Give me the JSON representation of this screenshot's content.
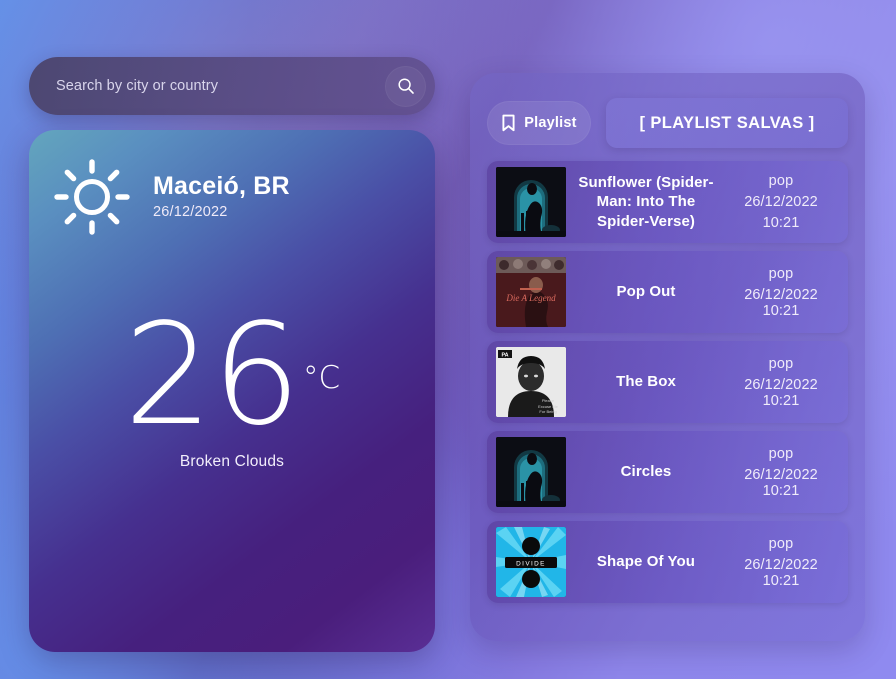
{
  "search": {
    "placeholder": "Search by city or country",
    "value": "",
    "icon": "search-icon"
  },
  "weather": {
    "icon": "sun-icon",
    "city": "Maceió, BR",
    "date": "26/12/2022",
    "temperature": "26",
    "unit": "°C",
    "description": "Broken Clouds"
  },
  "playlist": {
    "pill_label": "Playlist",
    "pill_icon": "bookmark-icon",
    "saved_button_label": "[ PLAYLIST SALVAS ]",
    "tracks": [
      {
        "title": "Sunflower (Spider-Man: Into The Spider-Verse)",
        "genre": "pop",
        "date": "26/12/2022",
        "time": "10:21",
        "cover": "sunflower-cover"
      },
      {
        "title": "Pop Out",
        "genre": "pop",
        "date": "26/12/2022",
        "time": "10:21",
        "cover": "pop-out-cover"
      },
      {
        "title": "The Box",
        "genre": "pop",
        "date": "26/12/2022",
        "time": "10:21",
        "cover": "the-box-cover"
      },
      {
        "title": "Circles",
        "genre": "pop",
        "date": "26/12/2022",
        "time": "10:21",
        "cover": "circles-cover"
      },
      {
        "title": "Shape Of You",
        "genre": "pop",
        "date": "26/12/2022",
        "time": "10:21",
        "cover": "shape-of-you-cover"
      }
    ]
  },
  "colors": {
    "background_blue": "#5c90ea",
    "background_purple": "#8f8af0",
    "card_teal": "#63a6bd",
    "card_purple": "#46207e",
    "text_light": "#ffffff"
  }
}
